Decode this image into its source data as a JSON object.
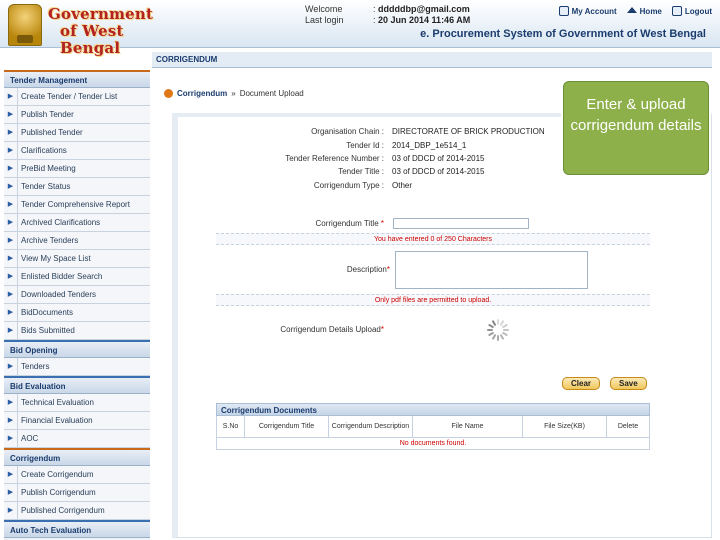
{
  "header": {
    "gov_title_line1": "Government",
    "gov_title_line2": "of West Bengal",
    "welcome_label": "Welcome",
    "welcome_value": "dddddbp@gmail.com",
    "last_login_label": "Last login",
    "last_login_value": "20 Jun 2014 11:46 AM",
    "my_account": "My Account",
    "home": "Home",
    "logout": "Logout",
    "system_title": "e. Procurement System of Government of West Bengal"
  },
  "main_head": "CORRIGENDUM",
  "breadcrumb": {
    "first": "Corrigendum",
    "sep": "»",
    "second": "Document Upload"
  },
  "sidebar": {
    "sections": [
      {
        "title": "Tender Management",
        "items": [
          "Create Tender / Tender List",
          "Publish Tender",
          "Published Tender",
          "Clarifications",
          "PreBid Meeting",
          "Tender Status",
          "Tender Comprehensive Report",
          "Archived Clarifications",
          "Archive Tenders",
          "View My Space List",
          "Enlisted Bidder Search",
          "Downloaded Tenders",
          "BidDocuments",
          "Bids Submitted"
        ]
      },
      {
        "title": "Bid Opening",
        "items": [
          "Tenders"
        ]
      },
      {
        "title": "Bid Evaluation",
        "items": [
          "Technical Evaluation",
          "Financial Evaluation",
          "AOC"
        ]
      },
      {
        "title": "Corrigendum",
        "items": [
          "Create Corrigendum",
          "Publish Corrigendum",
          "Published Corrigendum"
        ]
      },
      {
        "title": "Auto Tech Evaluation",
        "items": []
      }
    ]
  },
  "info": {
    "org_label": "Organisation Chain :",
    "org_value": "DIRECTORATE OF BRICK PRODUCTION",
    "tender_id_label": "Tender Id :",
    "tender_id_value": "2014_DBP_1e514_1",
    "ref_label": "Tender Reference Number :",
    "ref_value": "03 of DDCD of 2014-2015",
    "title_label": "Tender Title :",
    "title_value": "03 of DDCD of 2014-2015",
    "type_label": "Corrigendum Type :",
    "type_value": "Other"
  },
  "form": {
    "corr_title_label": "Corrigendum Title",
    "corr_title_value": "",
    "chars_hint": "You have entered 0 of 250 Characters",
    "desc_label": "Description",
    "desc_value": "",
    "pdf_hint": "Only pdf files are permitted to upload.",
    "upload_label": "Corrigendum Details Upload",
    "clear": "Clear",
    "save": "Save"
  },
  "docs": {
    "heading": "Corrigendum Documents",
    "columns": [
      "S.No",
      "Corrigendum Title",
      "Corrigendum Description",
      "File Name",
      "File Size(KB)",
      "Delete"
    ],
    "empty": "No documents found."
  },
  "callout": "Enter & upload corrigendum details",
  "colors": {
    "accent": "#1a3c6e",
    "callout": "#8db04a",
    "error": "#cc0000"
  }
}
